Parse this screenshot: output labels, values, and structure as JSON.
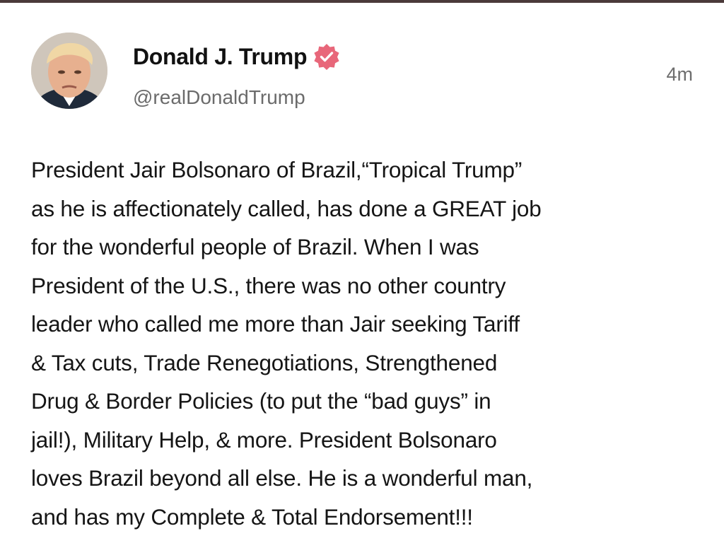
{
  "post": {
    "author": {
      "display_name": "Donald J. Trump",
      "handle": "@realDonaldTrump",
      "verified_icon": "verified-badge-icon",
      "badge_color": "#e8677a"
    },
    "timestamp": "4m",
    "body": "President Jair Bolsonaro of Brazil,“Tropical Trump”\nas he is affectionately called, has done a GREAT job\nfor the wonderful people of Brazil. When I was\nPresident of the U.S., there was no other country\nleader who called me more than Jair seeking Tariff\n& Tax cuts, Trade Renegotiations, Strengthened\nDrug & Border Policies (to put the “bad guys” in\njail!), Military Help, & more. President Bolsonaro\nloves Brazil beyond all else. He is a wonderful man,\nand has my Complete & Total Endorsement!!!"
  }
}
